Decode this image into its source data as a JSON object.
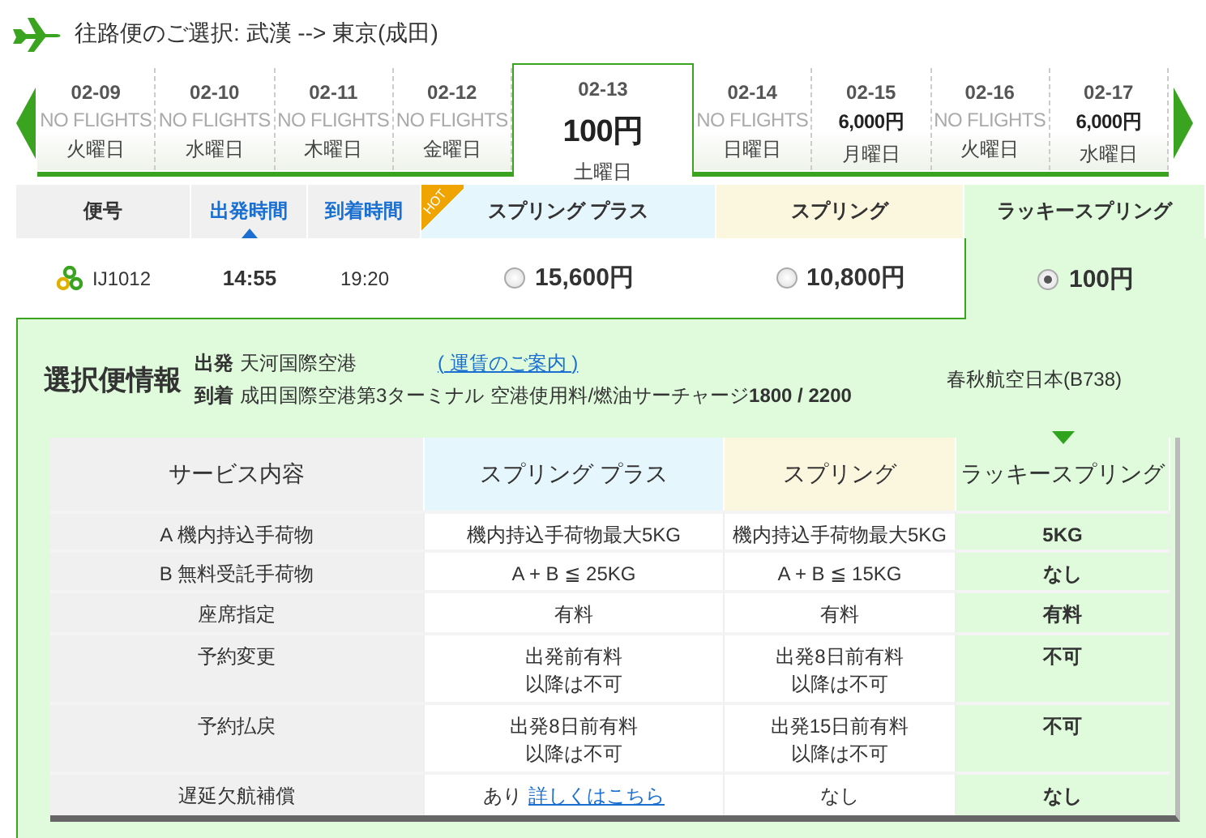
{
  "title": "往路便のご選択: 武漢 --> 東京(成田)",
  "dates": [
    {
      "date": "02-09",
      "fare": "NO FLIGHTS",
      "has_flights": false,
      "weekday": "火曜日",
      "selected": false
    },
    {
      "date": "02-10",
      "fare": "NO FLIGHTS",
      "has_flights": false,
      "weekday": "水曜日",
      "selected": false
    },
    {
      "date": "02-11",
      "fare": "NO FLIGHTS",
      "has_flights": false,
      "weekday": "木曜日",
      "selected": false
    },
    {
      "date": "02-12",
      "fare": "NO FLIGHTS",
      "has_flights": false,
      "weekday": "金曜日",
      "selected": false
    },
    {
      "date": "02-13",
      "fare": "100円",
      "has_flights": true,
      "weekday": "土曜日",
      "selected": true
    },
    {
      "date": "02-14",
      "fare": "NO FLIGHTS",
      "has_flights": false,
      "weekday": "日曜日",
      "selected": false
    },
    {
      "date": "02-15",
      "fare": "6,000円",
      "has_flights": true,
      "weekday": "月曜日",
      "selected": false
    },
    {
      "date": "02-16",
      "fare": "NO FLIGHTS",
      "has_flights": false,
      "weekday": "火曜日",
      "selected": false
    },
    {
      "date": "02-17",
      "fare": "6,000円",
      "has_flights": true,
      "weekday": "水曜日",
      "selected": false
    }
  ],
  "flight_table": {
    "columns": [
      {
        "label": "便号",
        "sortable": false
      },
      {
        "label": "出発時間",
        "sortable": true,
        "sorted": true
      },
      {
        "label": "到着時間",
        "sortable": true,
        "sorted": false
      }
    ],
    "fares": [
      {
        "name": "スプリング プラス",
        "color": "#e6f6fd",
        "hot": true,
        "hot_label": "HOT",
        "price": "15,600円",
        "selected": false
      },
      {
        "name": "スプリング",
        "color": "#fbf6de",
        "hot": false,
        "price": "10,800円",
        "selected": false
      },
      {
        "name": "ラッキースプリング",
        "color": "#dffbdc",
        "hot": false,
        "price": "100円",
        "selected": true
      }
    ],
    "row": {
      "flight": "IJ1012",
      "departure": "14:55",
      "arrival": "19:20"
    }
  },
  "info": {
    "heading": "選択便情報",
    "depart_label": "出発",
    "depart": "天河国際空港",
    "fare_link": "( 運賃のご案内 )",
    "arrive_label": "到着",
    "arrive": "成田国際空港第3ターミナル",
    "fees": "空港使用料/燃油サーチャージ**1800 / 2200**",
    "aircraft": "春秋航空日本(B738)"
  },
  "service_table": {
    "columns": [
      {
        "label": "サービス内容",
        "color": "#f0f0f0",
        "selected": false
      },
      {
        "label": "スプリング プラス",
        "color": "#e6f6fd",
        "selected": false
      },
      {
        "label": "スプリング",
        "color": "#fbf6de",
        "selected": false
      },
      {
        "label": "ラッキースプリング",
        "color": "#dffbdc",
        "selected": true
      }
    ],
    "rows": [
      {
        "cells": [
          {
            "text": "A 機内持込手荷物"
          },
          {
            "text": "機内持込手荷物最大5KG"
          },
          {
            "text": "機内持込手荷物最大5KG"
          },
          {
            "text": "5KG"
          }
        ]
      },
      {
        "cells": [
          {
            "text": "B 無料受託手荷物"
          },
          {
            "text": "A + B ≦ 25KG"
          },
          {
            "text": "A + B ≦ 15KG"
          },
          {
            "text": "なし"
          }
        ]
      },
      {
        "cells": [
          {
            "text": "座席指定"
          },
          {
            "text": "有料"
          },
          {
            "text": "有料"
          },
          {
            "text": "有料"
          }
        ]
      },
      {
        "cells": [
          {
            "text": "予約変更"
          },
          {
            "text": "出発前有料",
            "text2": "以降は不可"
          },
          {
            "text": "出発8日前有料",
            "text2": "以降は不可"
          },
          {
            "text": "不可"
          }
        ]
      },
      {
        "cells": [
          {
            "text": "予約払戻"
          },
          {
            "text": "出発8日前有料",
            "text2": "以降は不可"
          },
          {
            "text": "出発15日前有料",
            "text2": "以降は不可"
          },
          {
            "text": "不可"
          }
        ]
      },
      {
        "cells": [
          {
            "text": "遅延欠航補償"
          },
          {
            "text": "あり",
            "link": "詳しくはこちら"
          },
          {
            "text": "なし"
          },
          {
            "text": "なし"
          }
        ]
      }
    ]
  }
}
